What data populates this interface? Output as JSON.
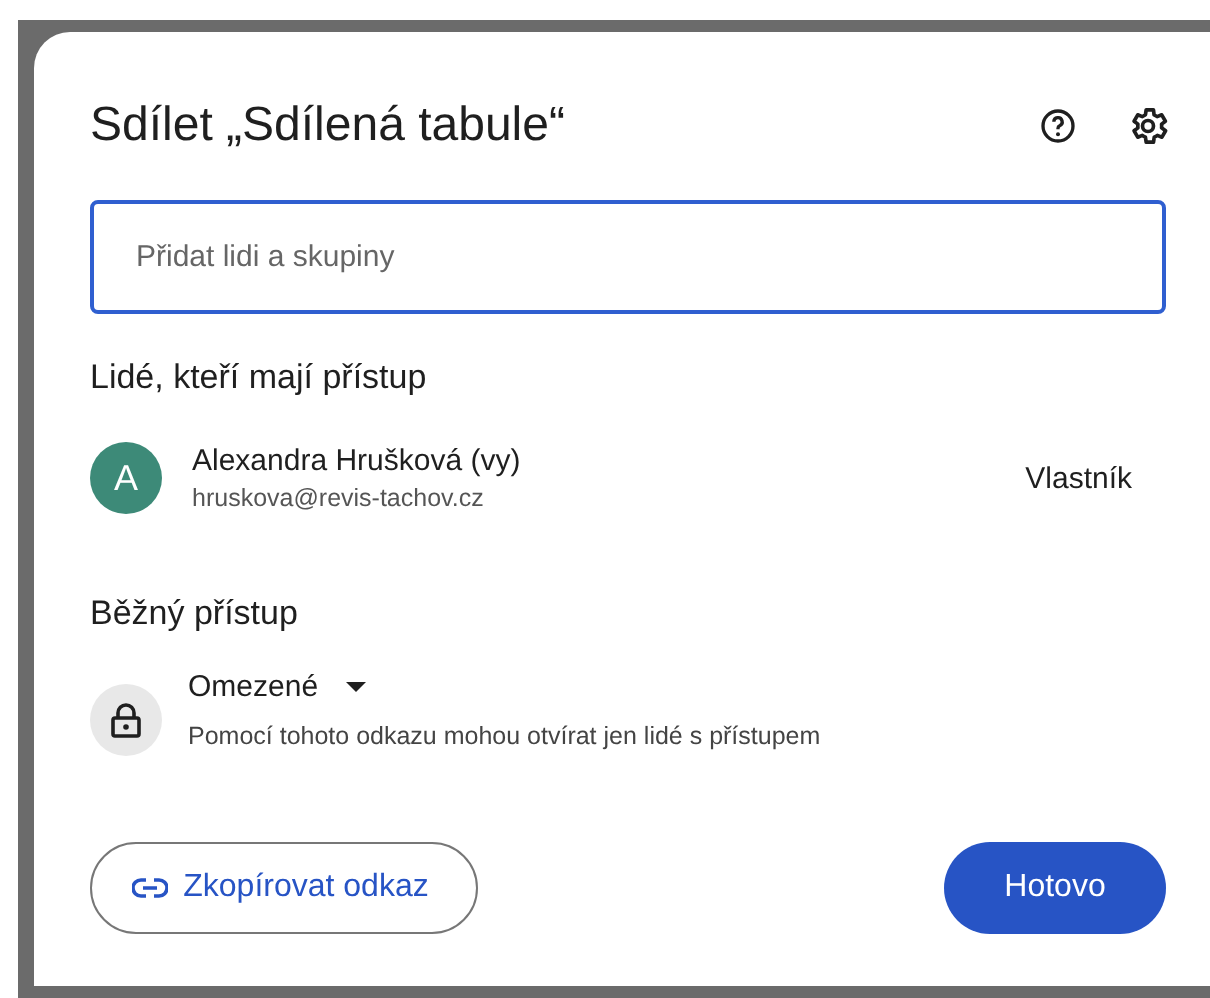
{
  "dialog": {
    "title": "Sdílet „Sdílená tabule“"
  },
  "search": {
    "placeholder": "Přidat lidi a skupiny"
  },
  "people_heading": "Lidé, kteří mají přístup",
  "people": [
    {
      "initial": "A",
      "name": "Alexandra Hrušková (vy)",
      "email": "hruskova@revis-tachov.cz",
      "role": "Vlastník",
      "color": "#3d8a78"
    }
  ],
  "general_access": {
    "heading": "Běžný přístup",
    "option": "Omezené",
    "description": "Pomocí tohoto odkazu mohou otvírat jen lidé s přístupem"
  },
  "buttons": [
    {
      "kind": "outlined",
      "label": "Zkopírovat odkaz"
    },
    {
      "kind": "filled",
      "label": "Hotovo"
    }
  ]
}
